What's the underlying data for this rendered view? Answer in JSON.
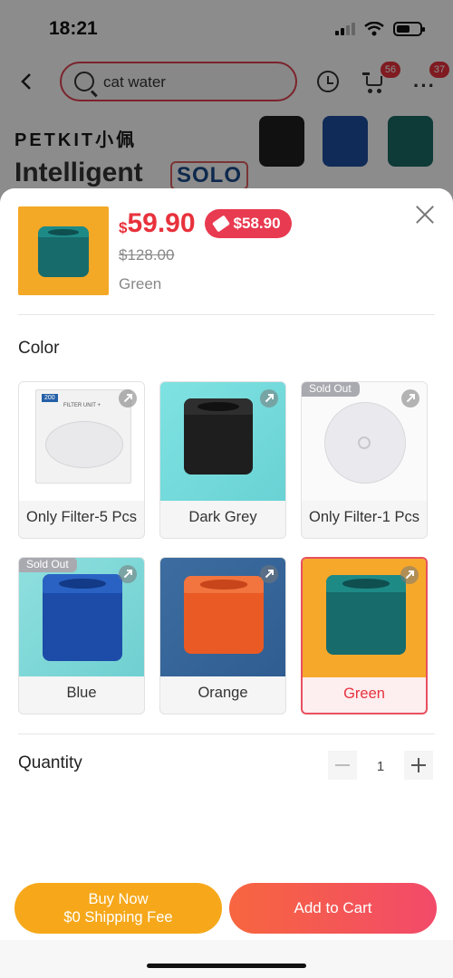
{
  "status_bar": {
    "time": "18:21"
  },
  "header": {
    "search_text": "cat water",
    "cart_badge": "56",
    "more_badge": "37"
  },
  "banner": {
    "brand": "PETKIT小佩",
    "title": "Intelligent",
    "tag": "SOLO"
  },
  "sheet": {
    "price_symbol": "$",
    "price": "59.90",
    "coupon_price": "$58.90",
    "old_price": "$128.00",
    "selected_variant": "Green",
    "color_title": "Color",
    "options": [
      {
        "label": "Only Filter-5 Pcs",
        "sold_out": false
      },
      {
        "label": "Dark Grey",
        "sold_out": false
      },
      {
        "label": "Only Filter-1 Pcs",
        "sold_out": true
      },
      {
        "label": "Blue",
        "sold_out": true
      },
      {
        "label": "Orange",
        "sold_out": false
      },
      {
        "label": "Green",
        "sold_out": false,
        "selected": true
      }
    ],
    "sold_out_text": "Sold Out",
    "quantity_title": "Quantity",
    "quantity": "1",
    "filter_box_label": "FILTER UNIT +",
    "filter_box_badge": "200"
  },
  "buttons": {
    "buy_now_line1": "Buy Now",
    "buy_now_line2": "$0 Shipping Fee",
    "add_to_cart": "Add to Cart"
  },
  "colors": {
    "accent": "#e8323c",
    "buy_now": "#f6a81a",
    "add_cart_start": "#f7663f",
    "add_cart_end": "#f24a6a"
  }
}
